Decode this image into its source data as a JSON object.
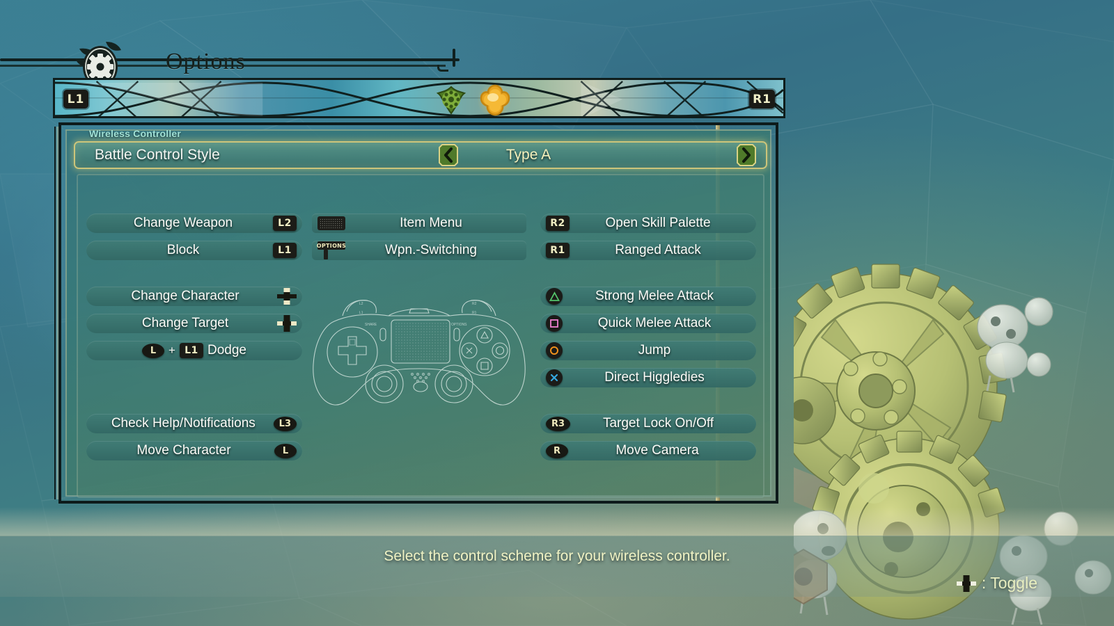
{
  "header": {
    "title": "Options",
    "gear_icon": "gear-medallion-icon",
    "leaf_left_icon": "leaf-sprig-icon",
    "leaf_right_icon": "leaf-sprig-icon"
  },
  "tabbar": {
    "left_bumper": "L1",
    "right_bumper": "R1",
    "tabs": [
      {
        "name": "tab-gameplay",
        "icon": "green-flower-icon",
        "selected": false,
        "color": "#6f9e37"
      },
      {
        "name": "tab-controls",
        "icon": "orange-flower-icon",
        "selected": true,
        "color": "#e8a020"
      }
    ]
  },
  "panel": {
    "subheading": "Wireless Controller",
    "option_row": {
      "label": "Battle Control Style",
      "value": "Type A",
      "left_arrow_icon": "chevron-left-icon",
      "right_arrow_icon": "chevron-right-icon",
      "selected": true,
      "highlight_color": "#cdc57a"
    },
    "controller_image": "dualshock-controller-diagram"
  },
  "bindings": {
    "left_column": [
      {
        "label": "Change Weapon",
        "icon": "L2",
        "icon_type": "rect",
        "icon_side": "right",
        "group": 1
      },
      {
        "label": "Block",
        "icon": "L1",
        "icon_type": "rect",
        "icon_side": "right",
        "group": 1
      },
      {
        "label": "Change Character",
        "icon": "dpad-up-down",
        "icon_type": "dpad",
        "icon_side": "right",
        "group": 2
      },
      {
        "label": "Change Target",
        "icon": "dpad-left-right",
        "icon_type": "dpad",
        "icon_side": "right",
        "group": 2
      },
      {
        "label": "Dodge",
        "icon": "L-stick + L1",
        "icon_type": "combo",
        "icon_side": "inline",
        "group": 2
      },
      {
        "label": "Check Help/Notifications",
        "icon": "L3",
        "icon_type": "oval",
        "icon_side": "right",
        "group": 3
      },
      {
        "label": "Move Character",
        "icon": "L",
        "icon_type": "oval",
        "icon_side": "right",
        "group": 3
      }
    ],
    "mid_column": [
      {
        "label": "Item Menu",
        "icon": "touchpad",
        "icon_type": "touchpad",
        "icon_side": "left"
      },
      {
        "label": "Wpn.-Switching",
        "icon": "OPTIONS",
        "icon_type": "options",
        "icon_side": "left"
      }
    ],
    "right_column": [
      {
        "label": "Open Skill Palette",
        "icon": "R2",
        "icon_type": "rect",
        "icon_side": "left",
        "group": 1
      },
      {
        "label": "Ranged Attack",
        "icon": "R1",
        "icon_type": "rect",
        "icon_side": "left",
        "group": 1
      },
      {
        "label": "Strong Melee Attack",
        "icon": "triangle",
        "icon_type": "circle",
        "icon_side": "left",
        "glyph_color": "#54c46a",
        "group": 2
      },
      {
        "label": "Quick Melee Attack",
        "icon": "square",
        "icon_type": "circle",
        "icon_side": "left",
        "glyph_color": "#f07fd0",
        "group": 2
      },
      {
        "label": "Jump",
        "icon": "circle",
        "icon_type": "circle",
        "icon_side": "left",
        "glyph_color": "#f0901c",
        "group": 2
      },
      {
        "label": "Direct Higgledies",
        "icon": "cross",
        "icon_type": "circle",
        "icon_side": "left",
        "glyph_color": "#35a8e0",
        "group": 2
      },
      {
        "label": "Target Lock On/Off",
        "icon": "R3",
        "icon_type": "oval",
        "icon_side": "left",
        "group": 3
      },
      {
        "label": "Move Camera",
        "icon": "R",
        "icon_type": "oval",
        "icon_side": "left",
        "group": 3
      }
    ]
  },
  "footer": {
    "hint": "Select the control scheme for your wireless controller.",
    "toggle_icon": "dpad-left-right-icon",
    "toggle_label": ": Toggle"
  },
  "decor": {
    "gears_art": "giant-gears-illustration",
    "creatures": "higgledy-creatures",
    "wrench_art": "wrench-and-nut-illustration"
  },
  "colors": {
    "panel_bg": "#3a7a78",
    "accent_gold": "#cdc57a",
    "subhead_cyan": "#9fe2d8",
    "hint_yellow": "#f0f3c4",
    "badge_dark": "#1c1c17",
    "badge_text": "#f1eec4"
  }
}
